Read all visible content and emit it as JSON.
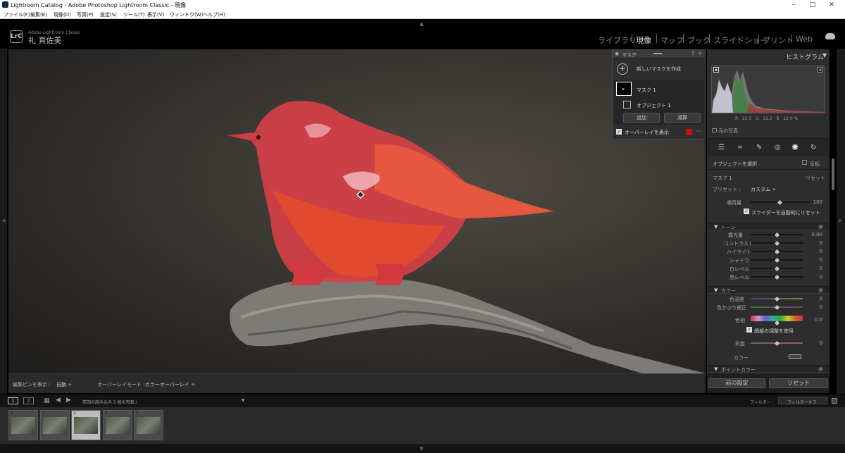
{
  "window": {
    "title": "Lightroom Catalog - Adobe Photoshop Lightroom Classic - 現像",
    "controls": [
      "–",
      "□",
      "✕"
    ]
  },
  "menu": [
    "ファイル(F)",
    "編集(E)",
    "現像(D)",
    "写真(P)",
    "設定(S)",
    "ツール(T)",
    "表示(V)",
    "ウィンドウ(W)",
    "ヘルプ(H)"
  ],
  "identity": {
    "logo": "LrC",
    "product": "Adobe Lightroom Classic",
    "user": "礼 真佐美"
  },
  "modules": [
    "ライブラリ",
    "現像",
    "マップ",
    "ブック",
    "スライドショー",
    "プリント",
    "Web"
  ],
  "active_module": "現像",
  "mask_panel": {
    "title": "マスク",
    "create": "新しいマスクを作成",
    "mask_name": "マスク 1",
    "object_name": "オブジェクト 1",
    "add": "追加",
    "subtract": "減算",
    "overlay": "オーバーレイを表示",
    "overlay_color": "#cc1111"
  },
  "histogram": {
    "title": "ヒストグラム",
    "r_label": "R",
    "r": "22.5",
    "g_label": "G",
    "g": "22.2",
    "b_label": "B",
    "b": "22.0",
    "percent": "%",
    "original": "元の写真"
  },
  "tools": [
    "sliders-icon",
    "crop-icon",
    "heal-icon",
    "redeye-icon",
    "mask-icon",
    "reset-icon"
  ],
  "mask_settings": {
    "object_select": "オブジェクトを選択",
    "invert": "反転",
    "mask_label": "マスク 1",
    "reset": "リセット",
    "preset_label": "プリセット :",
    "preset_value": "カスタム ÷",
    "amount_label": "適用量",
    "amount_value": "100",
    "auto_reset": "スライダーを自動的にリセット"
  },
  "tone": {
    "header": "トーン",
    "sliders": [
      {
        "label": "露光量",
        "value": "0.00"
      },
      {
        "label": "コントラスト",
        "value": "0"
      },
      {
        "label": "ハイライト",
        "value": "0"
      },
      {
        "label": "シャドウ",
        "value": "0"
      },
      {
        "label": "白レベル",
        "value": "0"
      },
      {
        "label": "黒レベル",
        "value": "0"
      }
    ]
  },
  "color": {
    "header": "カラー",
    "temp_label": "色温度",
    "temp_value": "0",
    "tint_label": "色かぶり補正",
    "tint_value": "0",
    "hue_label": "色相",
    "hue_value": "0.0",
    "fine": "細部の調整を使用",
    "sat_label": "彩度",
    "sat_value": "0",
    "color_label": "カラー"
  },
  "point_color": {
    "header": "ポイントカラー"
  },
  "panel_buttons": {
    "previous": "前の設定",
    "reset": "リセット"
  },
  "toolbar": {
    "pins_label": "編集ピンを表示 :",
    "pins_value": "自動 ÷",
    "overlay_mode_label": "オーバーレイモード :",
    "overlay_mode_value": "カラーオーバーレイ ÷"
  },
  "filmstrip": {
    "view1": "1",
    "view2": "2",
    "source": "前回の読み込み  5 枚の写真 /",
    "filter_label": "フィルター :",
    "filter_value": "フィルターオフ",
    "thumbnails": [
      "1",
      "2",
      "3",
      "4",
      "5"
    ],
    "selected": "3"
  }
}
